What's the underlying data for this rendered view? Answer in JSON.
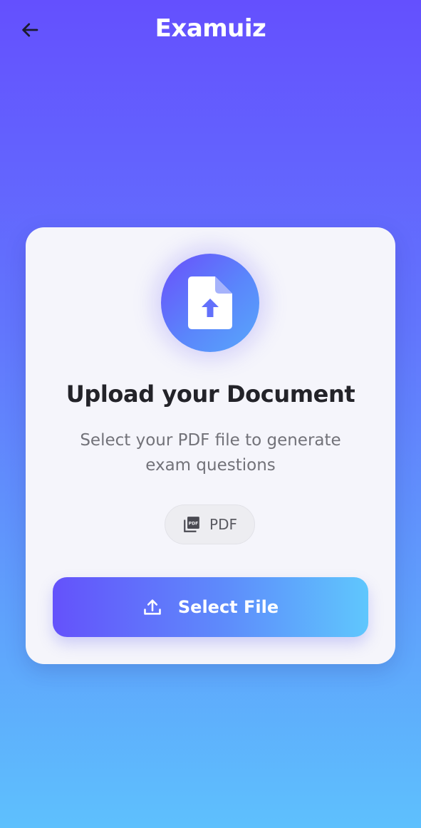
{
  "app_bar": {
    "title": "Examuiz",
    "back_icon": "arrow-back-icon"
  },
  "upload_card": {
    "icon": "file-upload-icon",
    "title": "Upload your Document",
    "subtitle": "Select your PDF file to generate exam questions",
    "file_type_chip": {
      "icon": "pdf-icon",
      "label": "PDF"
    },
    "select_button": {
      "icon": "upload-icon",
      "label": "Select File"
    }
  },
  "colors": {
    "gradient_top": "#6450fe",
    "gradient_bottom": "#5ec0fd",
    "card_background": "#f5f5fb",
    "title_text": "#232329",
    "subtitle_text": "#727279",
    "button_start": "#6452fb",
    "button_end": "#5fc7fd"
  }
}
